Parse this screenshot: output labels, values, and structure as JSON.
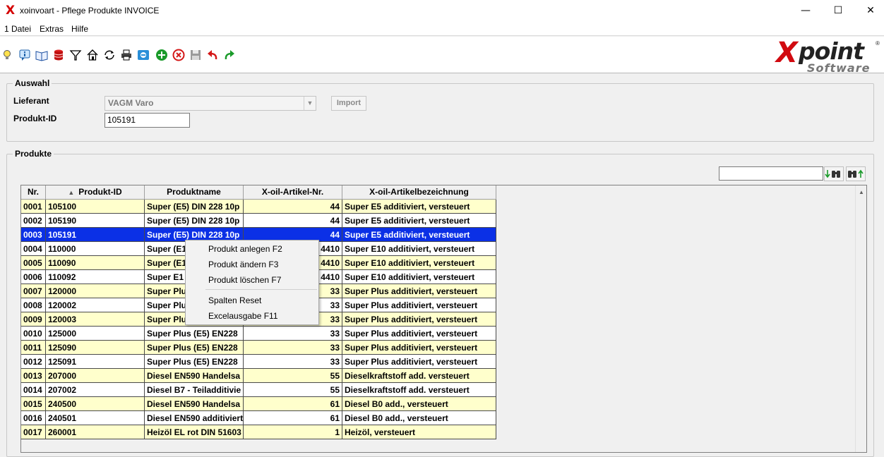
{
  "window": {
    "title": "xoinvoart - Pflege Produkte INVOICE",
    "icon": "X"
  },
  "menu": [
    "1 Datei",
    "Extras",
    "Hilfe"
  ],
  "toolbar_icons": [
    "lightbulb-icon",
    "info-icon",
    "book-icon",
    "database-icon",
    "filter-icon",
    "home-icon",
    "refresh-icon",
    "print-icon",
    "pin-icon",
    "add-icon",
    "cancel-icon",
    "save-icon",
    "undo-icon",
    "redo-icon"
  ],
  "logo": {
    "x": "X",
    "point": "point",
    "software": "Software",
    "reg": "®"
  },
  "auswahl": {
    "title": "Auswahl",
    "lieferant_label": "Lieferant",
    "lieferant_value": "VAGM  Varo",
    "import_label": "Import",
    "produkt_id_label": "Produkt-ID",
    "produkt_id_value": "105191"
  },
  "produkte": {
    "title": "Produkte",
    "search_value": "",
    "columns": [
      "Nr.",
      "Produkt-ID",
      "Produktname",
      "X-oil-Artikel-Nr.",
      "X-oil-Artikelbezeichnung"
    ],
    "sort_indicator": "▲",
    "selected_index": 2,
    "rows": [
      [
        "0001",
        "105100",
        "Super (E5) DIN 228 10p",
        "44",
        "Super E5 additiviert, versteuert"
      ],
      [
        "0002",
        "105190",
        "Super (E5) DIN 228 10p",
        "44",
        "Super E5 additiviert, versteuert"
      ],
      [
        "0003",
        "105191",
        "Super (E5) DIN 228 10p",
        "44",
        "Super E5 additiviert, versteuert"
      ],
      [
        "0004",
        "110000",
        "Super (E1",
        "4410",
        "Super E10 additiviert, versteuert"
      ],
      [
        "0005",
        "110090",
        "Super (E1",
        "4410",
        "Super E10 additiviert, versteuert"
      ],
      [
        "0006",
        "110092",
        "Super E1",
        "4410",
        "Super E10 additiviert, versteuert"
      ],
      [
        "0007",
        "120000",
        "Super Plu",
        "33",
        "Super Plus additiviert, versteuert"
      ],
      [
        "0008",
        "120002",
        "Super Plu",
        "33",
        "Super Plus additiviert, versteuert"
      ],
      [
        "0009",
        "120003",
        "Super Plu",
        "33",
        "Super Plus additiviert, versteuert"
      ],
      [
        "0010",
        "125000",
        "Super Plus (E5) EN228",
        "33",
        "Super Plus additiviert, versteuert"
      ],
      [
        "0011",
        "125090",
        "Super Plus (E5) EN228",
        "33",
        "Super Plus additiviert, versteuert"
      ],
      [
        "0012",
        "125091",
        "Super Plus (E5) EN228",
        "33",
        "Super Plus additiviert, versteuert"
      ],
      [
        "0013",
        "207000",
        "Diesel EN590 Handelsa",
        "55",
        "Dieselkraftstoff add. versteuert"
      ],
      [
        "0014",
        "207002",
        "Diesel B7 - Teiladditivie",
        "55",
        "Dieselkraftstoff add. versteuert"
      ],
      [
        "0015",
        "240500",
        "Diesel EN590 Handelsa",
        "61",
        "Diesel B0 add., versteuert"
      ],
      [
        "0016",
        "240501",
        "Diesel EN590 additiviert",
        "61",
        "Diesel B0 add., versteuert"
      ],
      [
        "0017",
        "260001",
        "Heizöl EL rot DIN 51603",
        "1",
        "Heizöl, versteuert"
      ]
    ]
  },
  "context_menu": {
    "items": [
      "Produkt anlegen F2",
      "Produkt ändern F3",
      "Produkt löschen F7",
      "Spalten Reset",
      "Excelausgabe F11"
    ]
  }
}
